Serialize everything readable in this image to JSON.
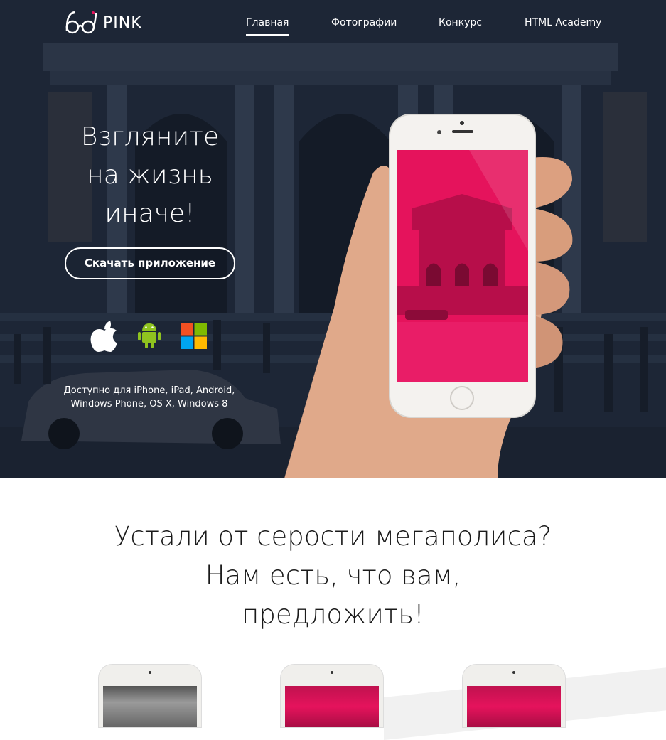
{
  "brand": {
    "name": "PINK"
  },
  "nav": {
    "items": [
      {
        "label": "Главная",
        "active": true
      },
      {
        "label": "Фотографии",
        "active": false
      },
      {
        "label": "Конкурс",
        "active": false
      },
      {
        "label": "HTML Academy",
        "active": false
      }
    ]
  },
  "hero": {
    "title_lines": [
      "Взгляните",
      "на жизнь",
      "иначе!"
    ],
    "download_label": "Скачать приложение",
    "platforms": [
      "apple-icon",
      "android-icon",
      "windows-icon"
    ],
    "available_lines": [
      "Доступно для iPhone, iPad, Android,",
      "Windows Phone, OS X, Windows 8"
    ]
  },
  "features": {
    "title_lines": [
      "Устали от серости мегаполиса?",
      "Нам есть, что вам,",
      "предложить!"
    ]
  },
  "colors": {
    "accent": "#e5135c",
    "hero_bg": "#1e2838"
  }
}
